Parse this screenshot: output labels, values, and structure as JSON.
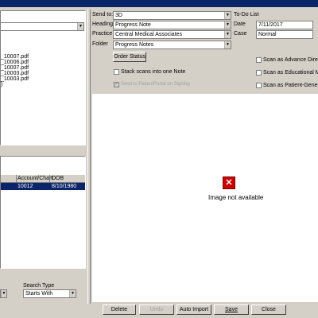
{
  "left": {
    "folder_combo": "",
    "files": [
      "_10007.pdf",
      "_10006.pdf",
      "_10007.pdf",
      "_10003.pdf",
      "_10003.pdf"
    ],
    "patient_table": {
      "headers": [
        "Account/Chart",
        "DOB"
      ],
      "rows": [
        {
          "account": "10012",
          "dob": "8/10/1980"
        }
      ]
    },
    "search_type_label": "Search Type",
    "search_type_value": "Starts With"
  },
  "form": {
    "send_to_label": "Send to:",
    "send_to_value": "3D",
    "todo_label": "To-Do List",
    "heading_label": "Heading",
    "heading_value": "Progress Note",
    "date_label": "Date",
    "date_value": "7/11/2017",
    "practice_label": "Practice",
    "practice_value": "Central Medical Associates",
    "case_label": "Case",
    "case_value": "Normal",
    "folder_label": "Folder",
    "folder_value": "Progress Notes",
    "order_status_label": "Order Status",
    "stack_scans_label": "Stack scans into one Note",
    "send_portal_label": "Send to PatientPortal on Signing",
    "scan_advance_label": "Scan as Advance Directive",
    "scan_educational_label": "Scan as Educational Mate",
    "scan_patient_label": "Scan as Patient-Generate"
  },
  "preview": {
    "not_available": "Image not available"
  },
  "buttons": {
    "delete": "Delete",
    "undo": "Undo",
    "auto_import": "Auto Import",
    "save": "Save",
    "close": "Close"
  },
  "colors": {
    "titlebar": "#0a246a",
    "selection": "#0a246a",
    "chrome": "#d4d0c8",
    "error_icon": "#cc0000"
  }
}
